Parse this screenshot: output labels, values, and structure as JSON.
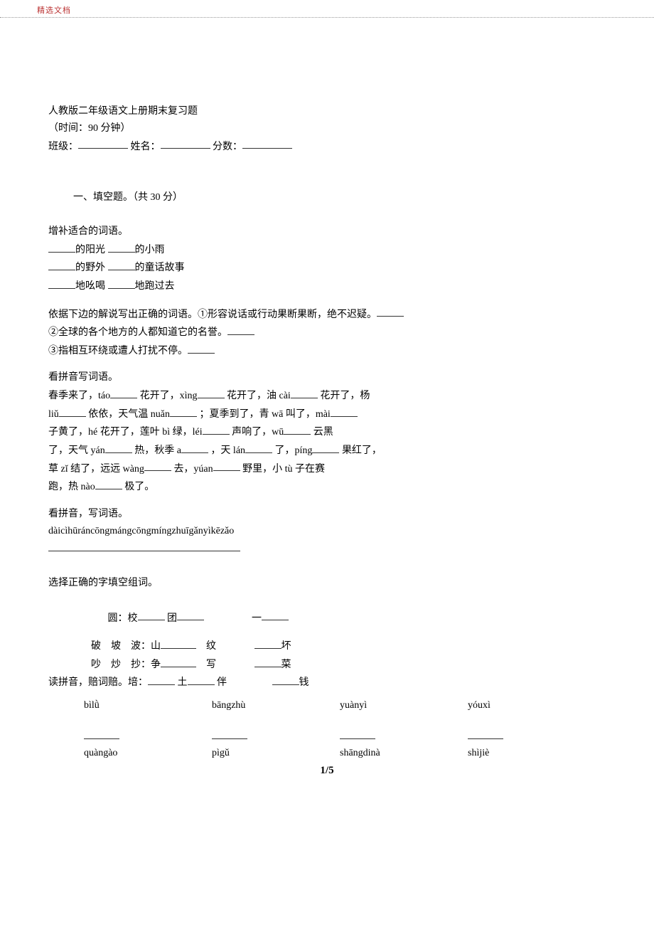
{
  "header": {
    "watermark": "精选文档"
  },
  "title": {
    "line1": "人教版二年级语文上册期末复习题",
    "line2": "（时间：90 分钟）",
    "form_prefix_class": "班级：",
    "form_middle_name": "姓名：",
    "form_end_score": "分数："
  },
  "section1": {
    "heading": "一、填空题。（共 30 分）",
    "q1": {
      "intro": "增补适合的词语。",
      "l1a": "的阳光",
      "l1b": "的小雨",
      "l2a": "的野外",
      "l2b": "的童话故事",
      "l3a": "地吆喝",
      "l3b": "地跑过去"
    },
    "q2": {
      "l1": "依据下边的解说写出正确的词语。①形容说话或行动果断果断，绝不迟疑。",
      "l2": "②全球的各个地方的人都知道它的名誉。",
      "l3": "③指相互环绕或遭人打扰不停。"
    },
    "q3": {
      "intro": "看拼音写词语。",
      "l1_a": "春季来了，táo",
      "l1_b": "花开了，xìng",
      "l1_c": "花开了，油 cài",
      "l1_d": "花开了，杨",
      "l2_a": "liǔ",
      "l2_b": "依依，天气温 nuǎn",
      "l2_c": "；夏季到了，青 wā 叫了，mài",
      "l3_a": "子黄了，hé 花开了，莲叶 bì",
      "l3_b": "绿，léi",
      "l3_c": "声响了，wū",
      "l3_d": "云黑",
      "l4_a": "了，天气 yán",
      "l4_b": "热，秋季 a",
      "l4_c": "，天 lán",
      "l4_d": "了，píng",
      "l4_e": "果红了，",
      "l5_a": "草 zǐ",
      "l5_b": "结了，远远 wàng",
      "l5_c": "去，yúan",
      "l5_d": "野里，小 tù",
      "l5_e": "子在赛",
      "l6_a": "跑，热 nào",
      "l6_b": "极了。"
    },
    "q4": {
      "intro": "看拼音，写词语。",
      "pinyin": "dàicìhūráncōngmángcōngmíngzhuīgǎnyìkēzǎo"
    },
    "q5": {
      "intro": "选择正确的字填空组词。",
      "r1_label": "圆：校",
      "r1_b": "团",
      "r1_c": "一",
      "r2_label": "破　坡　波：山",
      "r2_b": "纹",
      "r2_c": "坏",
      "r3_label": "吵　炒　抄：争",
      "r3_b": "写",
      "r3_c": "菜",
      "r4_prefix": "读拼音，赔词赔。培：",
      "r4_a": "土",
      "r4_b": "伴",
      "r4_c": "钱"
    },
    "q6": {
      "row1": {
        "c1": "bìlǜ",
        "c2": "bāngzhù",
        "c3": "yuànyì",
        "c4": "yóuxì"
      },
      "row2": {
        "c1": "quàngào",
        "c2": "pìgǔ",
        "c3": "shāngdinà",
        "c4": "shìjiè"
      }
    }
  },
  "page": {
    "num": "1/5"
  }
}
